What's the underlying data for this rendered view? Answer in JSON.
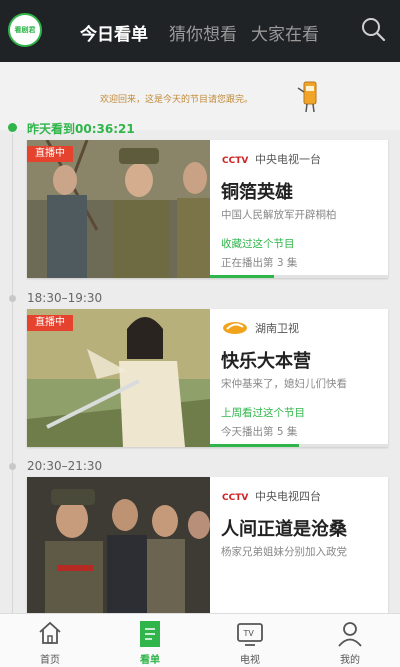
{
  "header": {
    "logo_text": "看剧君",
    "tabs": [
      {
        "label": "今日看单",
        "active": true
      },
      {
        "label": "猜你想看",
        "active": false
      },
      {
        "label": "大家在看",
        "active": false
      }
    ],
    "search_icon": "search-icon"
  },
  "welcome": {
    "text": "欢迎回来，这是今天的节目请您跟完。"
  },
  "timeline": [
    {
      "label": "昨天看到00:36:21",
      "highlight": true
    },
    {
      "label": "18:30–19:30",
      "highlight": false
    },
    {
      "label": "20:30–21:30",
      "highlight": false
    }
  ],
  "cards": [
    {
      "live_badge": "直播中",
      "channel": "中央电视一台",
      "channel_logo": "cctv-logo",
      "title": "铜箔英雄",
      "description": "中国人民解放军开辟桐柏",
      "watch_note": "收藏过这个节目",
      "airing": "正在播出第 3 集",
      "progress": 0.36
    },
    {
      "live_badge": "直播中",
      "channel": "湖南卫视",
      "channel_logo": "hunan-tv-logo",
      "title": "快乐大本营",
      "description": "宋仲基来了，媳妇儿们快看",
      "watch_note": "上周看过这个节目",
      "airing": "今天播出第 5 集",
      "progress": 0.5
    },
    {
      "live_badge": "",
      "channel": "中央电视四台",
      "channel_logo": "cctv-logo",
      "title": "人间正道是沧桑",
      "description": "杨家兄弟姐妹分别加入政党",
      "watch_note": "",
      "airing": "",
      "progress": 0
    }
  ],
  "bottom_nav": [
    {
      "label": "首页",
      "icon": "home-icon",
      "active": false
    },
    {
      "label": "看单",
      "icon": "list-icon",
      "active": true
    },
    {
      "label": "电视",
      "icon": "tv-icon",
      "active": false
    },
    {
      "label": "我的",
      "icon": "user-icon",
      "active": false
    }
  ],
  "colors": {
    "accent": "#2fb54a",
    "live": "#e5432e",
    "header_bg": "#202326"
  }
}
